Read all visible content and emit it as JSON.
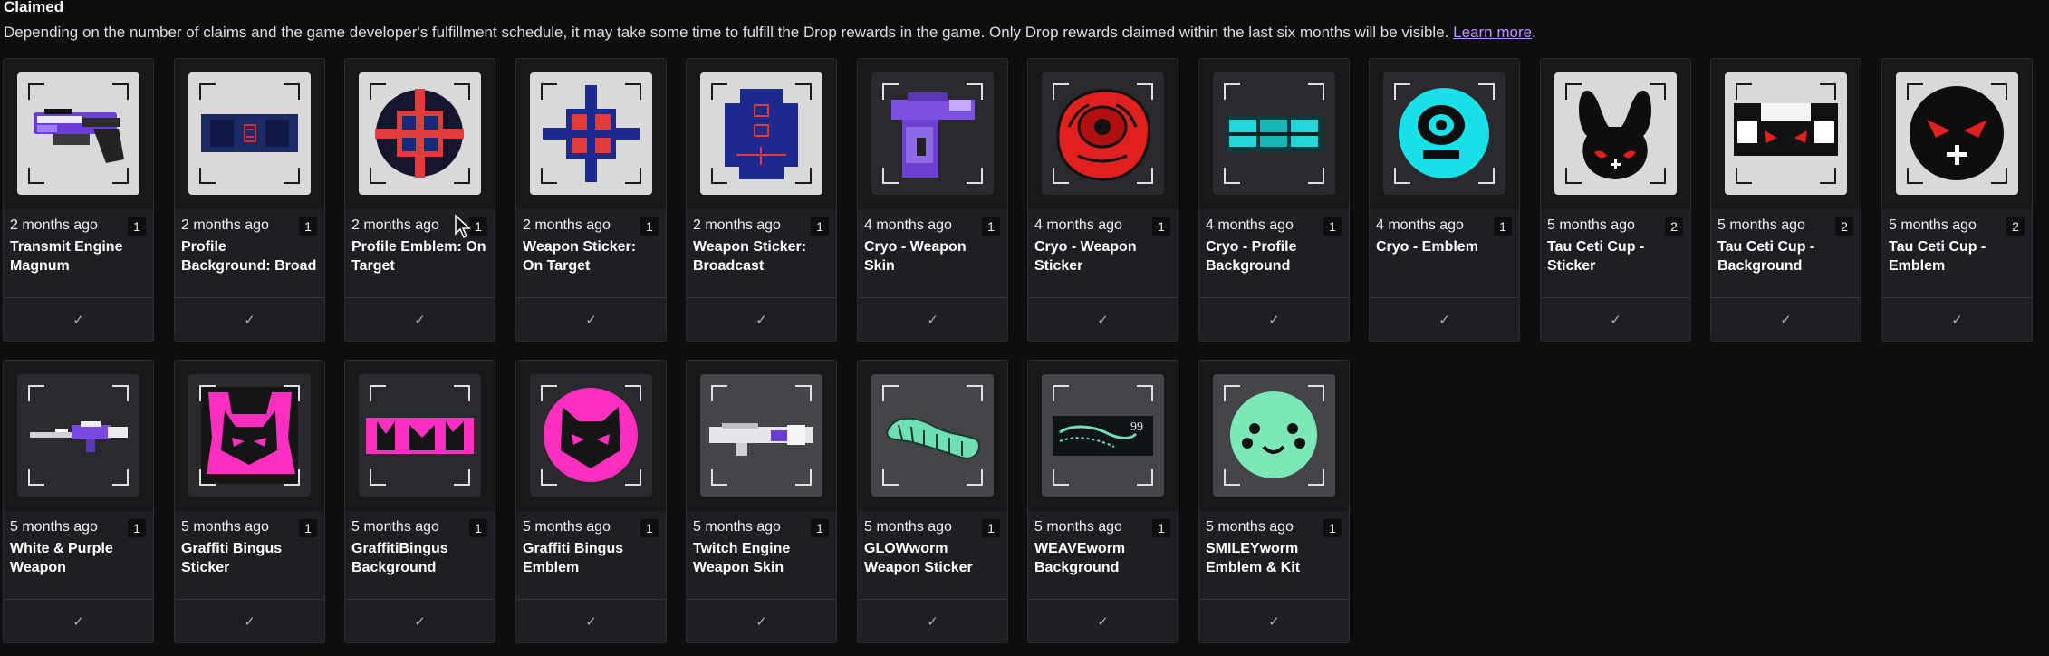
{
  "header": {
    "title": "Claimed",
    "description": "Depending on the number of claims and the game developer's fulfillment schedule, it may take some time to fulfill the Drop rewards in the game. Only Drop rewards claimed within the last six months will be visible.",
    "learn_more": "Learn more",
    "period": "."
  },
  "check_icon": "check-icon",
  "check_glyph": "✓",
  "items": [
    {
      "date": "2 months ago",
      "count": "1",
      "name": "Transmit Engine Magnum",
      "icon": "weapon-skin-purple-pistol"
    },
    {
      "date": "2 months ago",
      "count": "1",
      "name": "Profile Background: Broad",
      "icon": "profile-background-blue"
    },
    {
      "date": "2 months ago",
      "count": "1",
      "name": "Profile Emblem: On Target",
      "icon": "crosshair-emblem"
    },
    {
      "date": "2 months ago",
      "count": "1",
      "name": "Weapon Sticker: On Target",
      "icon": "crosshair-sticker"
    },
    {
      "date": "2 months ago",
      "count": "1",
      "name": "Weapon Sticker: Broadcast",
      "icon": "broadcast-sticker"
    },
    {
      "date": "4 months ago",
      "count": "1",
      "name": "Cryo - Weapon Skin",
      "icon": "cryo-pistol"
    },
    {
      "date": "4 months ago",
      "count": "1",
      "name": "Cryo - Weapon Sticker",
      "icon": "red-eye-sticker"
    },
    {
      "date": "4 months ago",
      "count": "1",
      "name": "Cryo - Profile Background",
      "icon": "cyan-background"
    },
    {
      "date": "4 months ago",
      "count": "1",
      "name": "Cryo - Emblem",
      "icon": "cyan-eye-emblem"
    },
    {
      "date": "5 months ago",
      "count": "2",
      "name": "Tau Ceti Cup - Sticker",
      "icon": "bunny-sticker"
    },
    {
      "date": "5 months ago",
      "count": "2",
      "name": "Tau Ceti Cup - Background",
      "icon": "tau-ceti-background"
    },
    {
      "date": "5 months ago",
      "count": "2",
      "name": "Tau Ceti Cup - Emblem",
      "icon": "red-eyes-emblem"
    },
    {
      "date": "5 months ago",
      "count": "1",
      "name": "White & Purple Weapon",
      "icon": "white-purple-rifle"
    },
    {
      "date": "5 months ago",
      "count": "1",
      "name": "Graffiti Bingus Sticker",
      "icon": "graffiti-cat-sticker"
    },
    {
      "date": "5 months ago",
      "count": "1",
      "name": "GraffitiBingus Background",
      "icon": "graffiti-background"
    },
    {
      "date": "5 months ago",
      "count": "1",
      "name": "Graffiti Bingus Emblem",
      "icon": "pink-cat-emblem"
    },
    {
      "date": "5 months ago",
      "count": "1",
      "name": "Twitch Engine Weapon Skin",
      "icon": "twitch-engine-rifle"
    },
    {
      "date": "5 months ago",
      "count": "1",
      "name": "GLOWworm Weapon Sticker",
      "icon": "glowworm-sticker"
    },
    {
      "date": "5 months ago",
      "count": "1",
      "name": "WEAVEworm Background",
      "icon": "weaveworm-background"
    },
    {
      "date": "5 months ago",
      "count": "1",
      "name": "SMILEYworm Emblem & Kit",
      "icon": "smiley-emblem"
    }
  ],
  "art_labels": {
    "weaveworm_number": "99"
  }
}
